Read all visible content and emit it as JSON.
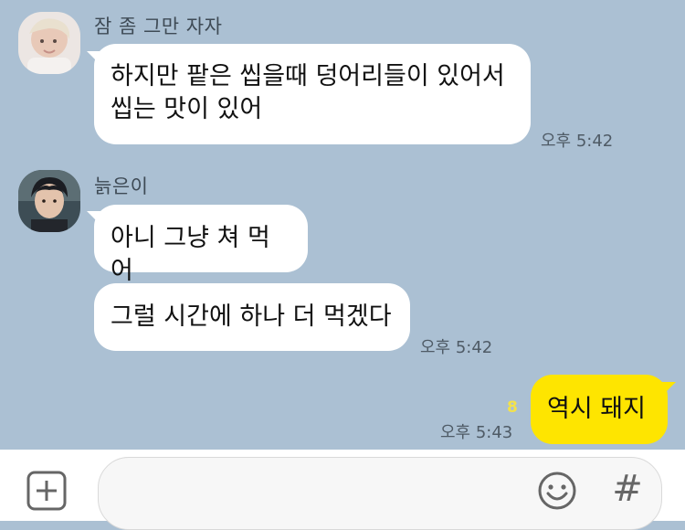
{
  "messages": [
    {
      "sender": "잠 좀 그만 자자",
      "avatar_icon": "profile-photo-1",
      "bubbles": [
        "하지만 팥은 씹을때 덩어리들이 있어서\n씹는 맛이 있어"
      ],
      "time": "오후 5:42"
    },
    {
      "sender": "늙은이",
      "avatar_icon": "profile-photo-2",
      "bubbles": [
        "아니 그냥 쳐 먹어",
        "그럴 시간에 하나 더 먹겠다"
      ],
      "time": "오후 5:42"
    },
    {
      "sender": "",
      "mine": true,
      "bubbles": [
        "역시 돼지"
      ],
      "unread": "8",
      "time": "오후 5:43"
    }
  ],
  "input": {
    "placeholder": "",
    "plus_icon": "plus-square-icon",
    "emoji_icon": "smile-icon",
    "hash_label": "#"
  },
  "colors": {
    "background": "#abc0d3",
    "my_bubble": "#fee500",
    "other_bubble": "#ffffff",
    "unread": "#f3e24a"
  }
}
